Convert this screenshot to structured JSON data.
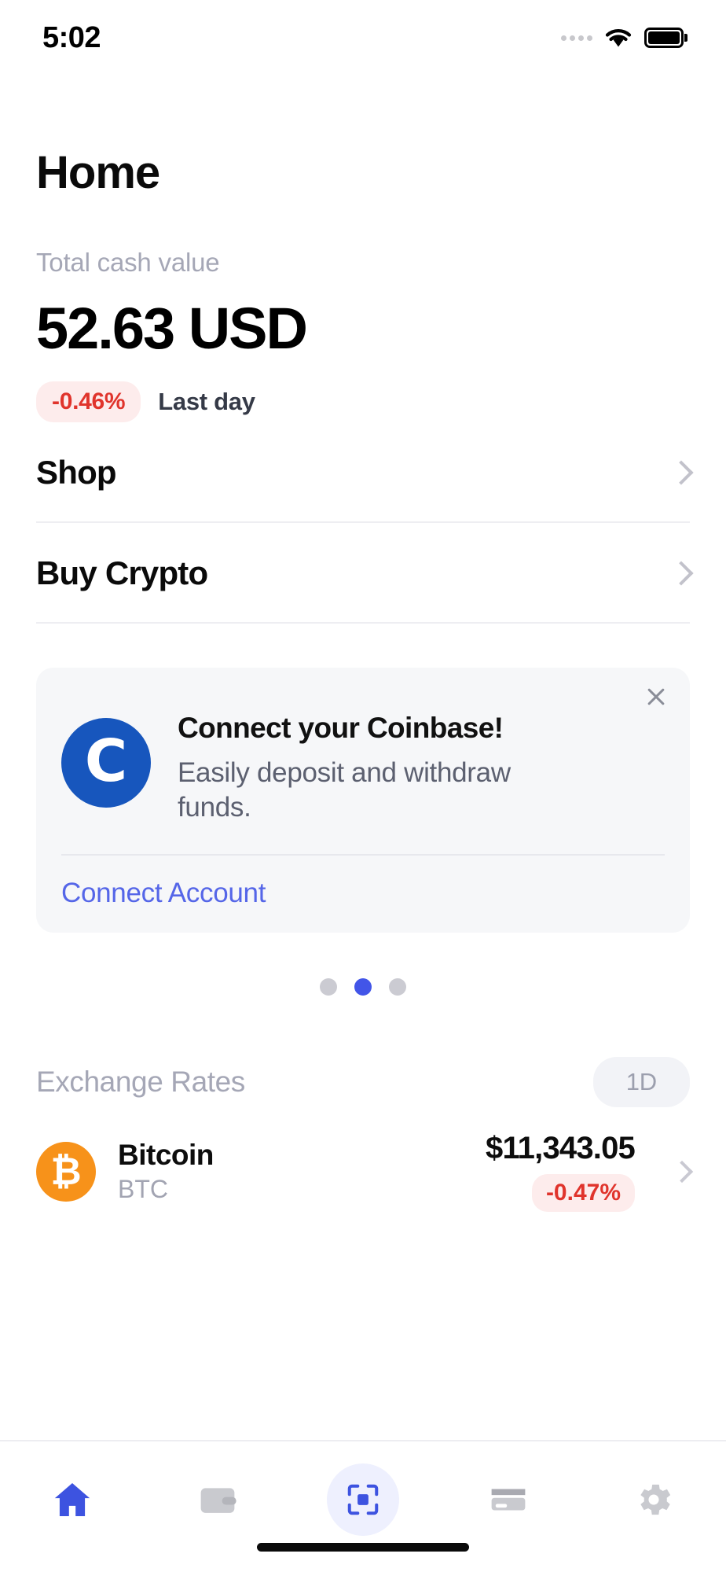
{
  "status_bar": {
    "time": "5:02",
    "signal_icon": "signal-dots-icon",
    "wifi_icon": "wifi-icon",
    "battery_icon": "battery-full-icon"
  },
  "header": {
    "title": "Home"
  },
  "balance": {
    "label": "Total cash value",
    "amount": "52.63 USD",
    "change": "-0.46%",
    "change_caption": "Last day",
    "change_color": "#e0342c",
    "change_bg": "#fdecec"
  },
  "nav_rows": [
    {
      "label": "Shop",
      "chevron": "chevron-right-icon"
    },
    {
      "label": "Buy Crypto",
      "chevron": "chevron-right-icon"
    }
  ],
  "promo": {
    "close_icon": "close-icon",
    "logo_letter": "C",
    "logo_color": "#1756bd",
    "title": "Connect your Coinbase!",
    "subtitle": "Easily deposit and withdraw funds.",
    "action": "Connect Account",
    "action_color": "#5566e8"
  },
  "carousel": {
    "total": 3,
    "active_index": 1,
    "active_color": "#4255e8",
    "inactive_color": "#cbcbd2"
  },
  "exchange_rates": {
    "title": "Exchange Rates",
    "range_chip": "1D",
    "rows": [
      {
        "icon": "bitcoin-icon",
        "icon_color": "#f7921a",
        "symbol_glyph": "₿",
        "name": "Bitcoin",
        "ticker": "BTC",
        "price": "$11,343.05",
        "change": "-0.47%",
        "chevron": "chevron-right-icon"
      }
    ]
  },
  "tabbar": {
    "items": [
      {
        "name": "home",
        "icon": "home-icon",
        "active": true
      },
      {
        "name": "wallet",
        "icon": "wallet-icon",
        "active": false
      },
      {
        "name": "scan",
        "icon": "scan-qr-icon",
        "active": true
      },
      {
        "name": "card",
        "icon": "credit-card-icon",
        "active": false
      },
      {
        "name": "settings",
        "icon": "gear-icon",
        "active": false
      }
    ],
    "active_color": "#3d53e0",
    "inactive_color": "#c9cacf"
  }
}
